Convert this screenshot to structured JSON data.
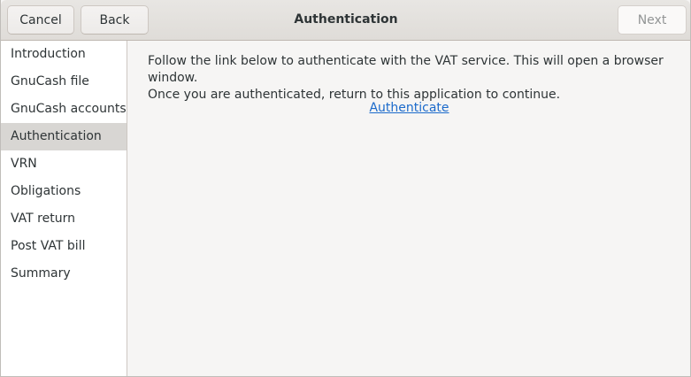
{
  "header": {
    "title": "Authentication",
    "cancel_label": "Cancel",
    "back_label": "Back",
    "next_label": "Next"
  },
  "sidebar": {
    "items": [
      {
        "label": "Introduction"
      },
      {
        "label": "GnuCash file"
      },
      {
        "label": "GnuCash accounts"
      },
      {
        "label": "Authentication",
        "selected": true
      },
      {
        "label": "VRN"
      },
      {
        "label": "Obligations"
      },
      {
        "label": "VAT return"
      },
      {
        "label": "Post VAT bill"
      },
      {
        "label": "Summary"
      }
    ]
  },
  "main": {
    "instructions_line1": "Follow the link below to authenticate with the VAT service. This will open a browser window.",
    "instructions_line2": "Once you are authenticated, return to this application to continue.",
    "authenticate_link": "Authenticate"
  },
  "colors": {
    "link": "#1b6acb",
    "selected_row": "#d8d6d3",
    "window_bg": "#f6f5f4"
  }
}
